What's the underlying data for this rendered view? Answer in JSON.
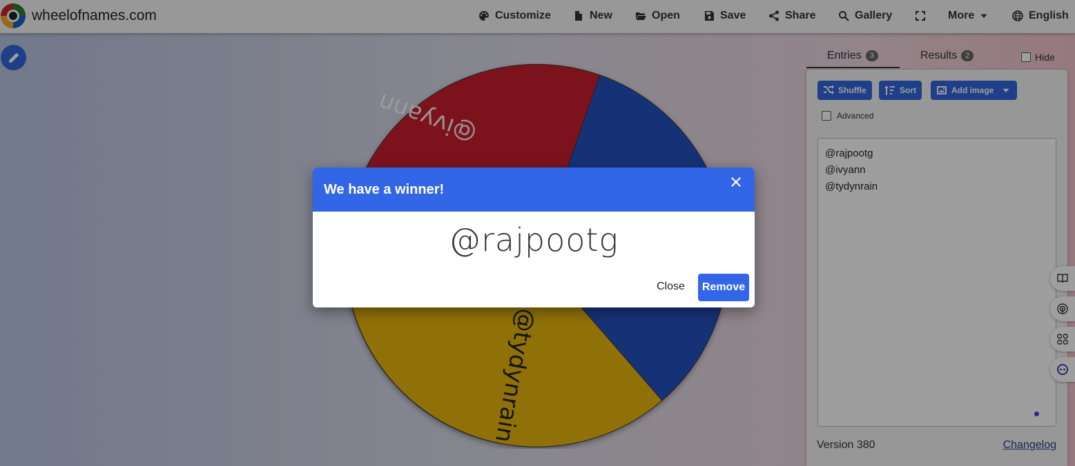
{
  "site": {
    "name": "wheelofnames.com"
  },
  "nav": {
    "customize": "Customize",
    "new": "New",
    "open": "Open",
    "save": "Save",
    "share": "Share",
    "gallery": "Gallery",
    "more": "More",
    "language": "English"
  },
  "wheel": {
    "slices": [
      {
        "label": "@ivyann",
        "color": "#c8202e"
      },
      {
        "label": "@rajpootg",
        "color": "#2552c0"
      },
      {
        "label": "@tydynrain",
        "color": "#e8b60d"
      }
    ]
  },
  "panel": {
    "tabs": [
      {
        "label": "Entries",
        "count": "3"
      },
      {
        "label": "Results",
        "count": "2"
      }
    ],
    "hide_label": "Hide",
    "shuffle_label": "Shuffle",
    "sort_label": "Sort",
    "add_image_label": "Add image",
    "advanced_label": "Advanced",
    "entries": [
      "@rajpootg",
      "@ivyann",
      "@tydynrain"
    ],
    "version": "Version 380",
    "changelog": "Changelog"
  },
  "dialog": {
    "title": "We have a winner!",
    "winner": "@rajpootg",
    "close_label": "Close",
    "remove_label": "Remove"
  },
  "colors": {
    "accent": "#3366e6"
  }
}
